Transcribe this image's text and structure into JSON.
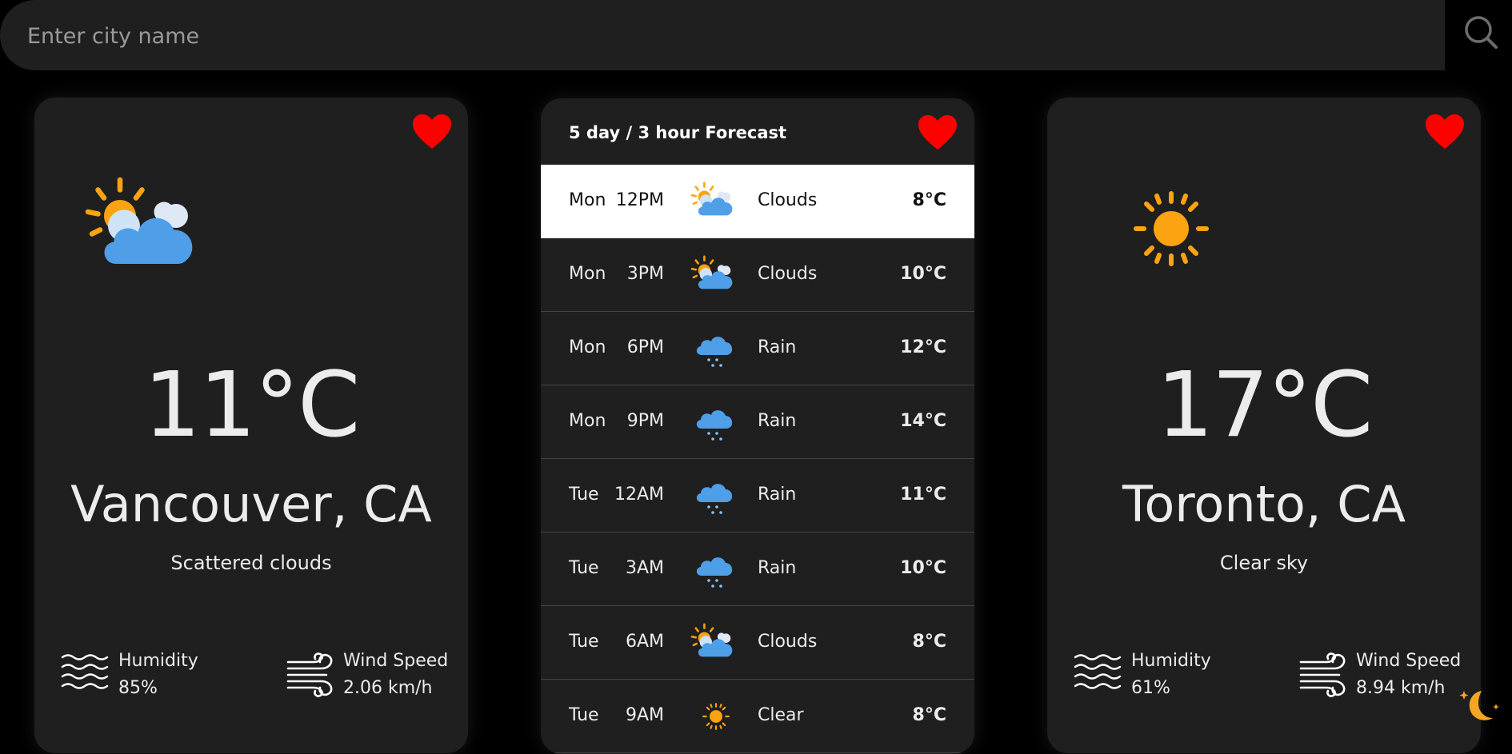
{
  "search": {
    "placeholder": "Enter city name",
    "value": ""
  },
  "colors": {
    "background": "#000000",
    "card": "#1f1f1f",
    "heart": "#ff0000",
    "sun": "#fca311",
    "cloud": "#4f9ee8",
    "moon": "#f5a623"
  },
  "left_card": {
    "icon": "sun-cloud-icon",
    "temperature": "11°C",
    "city": "Vancouver, CA",
    "description": "Scattered clouds",
    "humidity_label": "Humidity",
    "humidity_value": "85%",
    "wind_label": "Wind Speed",
    "wind_value": "2.06 km/h"
  },
  "forecast": {
    "title": "5 day / 3 hour Forecast",
    "rows": [
      {
        "day": "Mon",
        "time": "12PM",
        "icon": "sun-cloud-icon",
        "condition": "Clouds",
        "temp": "8°C"
      },
      {
        "day": "Mon",
        "time": "3PM",
        "icon": "sun-cloud-icon",
        "condition": "Clouds",
        "temp": "10°C"
      },
      {
        "day": "Mon",
        "time": "6PM",
        "icon": "rain-cloud-icon",
        "condition": "Rain",
        "temp": "12°C"
      },
      {
        "day": "Mon",
        "time": "9PM",
        "icon": "rain-cloud-icon",
        "condition": "Rain",
        "temp": "14°C"
      },
      {
        "day": "Tue",
        "time": "12AM",
        "icon": "rain-cloud-icon",
        "condition": "Rain",
        "temp": "11°C"
      },
      {
        "day": "Tue",
        "time": "3AM",
        "icon": "rain-cloud-icon",
        "condition": "Rain",
        "temp": "10°C"
      },
      {
        "day": "Tue",
        "time": "6AM",
        "icon": "sun-cloud-icon",
        "condition": "Clouds",
        "temp": "8°C"
      },
      {
        "day": "Tue",
        "time": "9AM",
        "icon": "sun-icon",
        "condition": "Clear",
        "temp": "8°C"
      }
    ]
  },
  "right_card": {
    "icon": "sun-icon",
    "temperature": "17°C",
    "city": "Toronto, CA",
    "description": "Clear sky",
    "humidity_label": "Humidity",
    "humidity_value": "61%",
    "wind_label": "Wind Speed",
    "wind_value": "8.94 km/h"
  }
}
